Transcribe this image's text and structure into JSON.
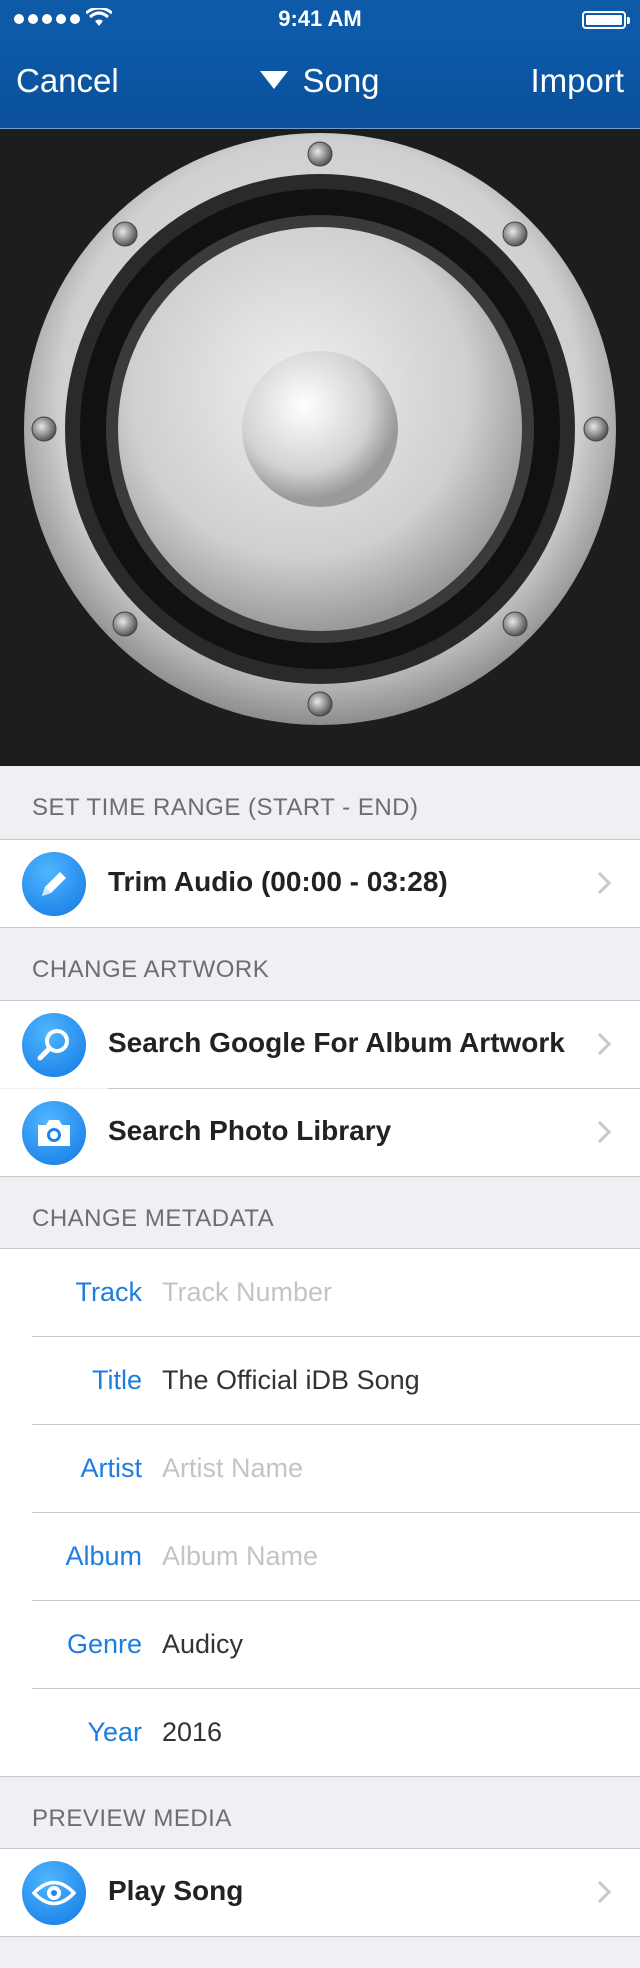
{
  "status_bar": {
    "time": "9:41 AM"
  },
  "nav": {
    "left_label": "Cancel",
    "title": "Song",
    "right_label": "Import"
  },
  "sections": {
    "time_range": {
      "header": "SET TIME RANGE (START - END)",
      "row": {
        "label": "Trim Audio (00:00 - 03:28)",
        "icon": "pencil-icon"
      }
    },
    "artwork": {
      "header": "CHANGE ARTWORK",
      "rows": [
        {
          "label": "Search Google For Album Artwork",
          "icon": "magnifier-icon"
        },
        {
          "label": "Search Photo Library",
          "icon": "camera-icon"
        }
      ]
    },
    "metadata": {
      "header": "CHANGE METADATA",
      "fields": [
        {
          "key": "Track",
          "value": "",
          "placeholder": "Track Number"
        },
        {
          "key": "Title",
          "value": "The Official iDB Song",
          "placeholder": ""
        },
        {
          "key": "Artist",
          "value": "",
          "placeholder": "Artist Name"
        },
        {
          "key": "Album",
          "value": "",
          "placeholder": "Album Name"
        },
        {
          "key": "Genre",
          "value": "Audicy",
          "placeholder": ""
        },
        {
          "key": "Year",
          "value": "2016",
          "placeholder": ""
        }
      ]
    },
    "preview": {
      "header": "PREVIEW MEDIA",
      "row": {
        "label": "Play Song",
        "icon": "eye-icon"
      }
    }
  },
  "colors": {
    "nav": "#0c5aa8",
    "accent": "#1e7ee0",
    "icon": "#1a86f0"
  }
}
